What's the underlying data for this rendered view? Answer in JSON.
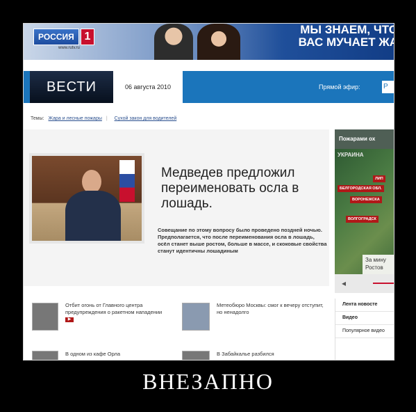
{
  "caption": "ВНЕЗАПНО",
  "banner": {
    "logo_word": "РОССИЯ",
    "logo_num": "1",
    "logo_url": "www.rutv.ru",
    "slogan_line1": "МЫ ЗНАЕМ, ЧТО",
    "slogan_line2": "ВАС МУЧАЕТ ЖА"
  },
  "header": {
    "logo": "ВЕСТИ",
    "date": "06 августа 2010",
    "live_label": "Прямой эфир:",
    "live_box": "Р"
  },
  "topics": {
    "label": "Темы:",
    "items": [
      "Жара и лесные пожары",
      "Сухой закон для водителей"
    ]
  },
  "main_story": {
    "headline": "Медведев предложил переименовать осла в лошадь.",
    "lead": "Совещание по этому вопросу было проведено поздней ночью. Предполагается, что после переименования осла в лошадь, осёл станет выше ростом, больше в массе, и скоковые свойства станут идентичны лошадиным"
  },
  "widget": {
    "title": "Пожарами ох",
    "map_label": "УКРАИНА",
    "fires": [
      "ЛИП",
      "БЕЛГОРОДСКАЯ ОБЛ.",
      "ВОРОНЕЖСКА",
      "ВОЛГОГРАДСК"
    ],
    "note_line1": "За мину",
    "note_line2": "Ростов",
    "nav_arrow": "◂"
  },
  "news": [
    {
      "text": "Отбит огонь от Главного центра предупреждения о ракетном нападении",
      "video": "▶"
    },
    {
      "text": "Метеобюро Москвы: смог к вечеру отступит, но ненадолго",
      "video": ""
    },
    {
      "text": "В одном из кафе Орла",
      "video": ""
    },
    {
      "text": "В Забайкалье разбился",
      "video": ""
    }
  ],
  "side_list": [
    "Лента новосте",
    "Видео",
    "Популярное видео"
  ]
}
